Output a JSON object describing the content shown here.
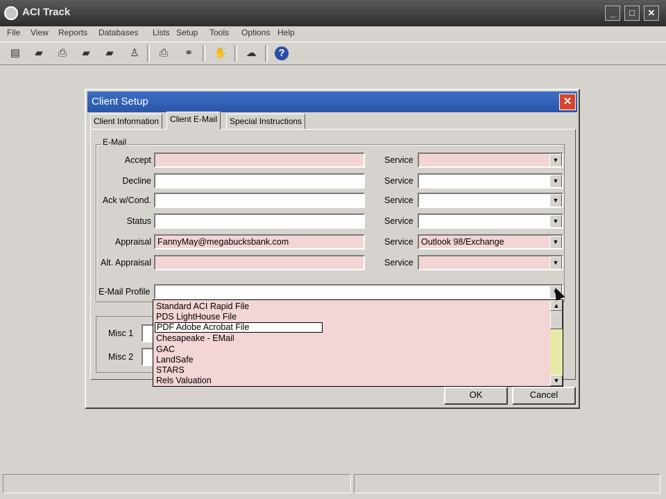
{
  "app": {
    "title": "ACI Track",
    "window_buttons": {
      "minimize": "_",
      "maximize": "□",
      "close": "✕"
    }
  },
  "menu": [
    "File",
    "View",
    "Reports",
    "Databases",
    "Lists",
    "Setup",
    "Tools",
    "Options",
    "Help"
  ],
  "toolbar": {
    "buttons": [
      {
        "icon": "new-document-icon",
        "glyph": "▤"
      },
      {
        "icon": "open-folder-icon",
        "glyph": "▰"
      },
      {
        "icon": "print-icon",
        "glyph": "⎙"
      },
      {
        "icon": "folder-icon",
        "glyph": "▰"
      },
      {
        "icon": "open-file-icon",
        "glyph": "▰"
      },
      {
        "icon": "person-icon",
        "glyph": "♙"
      },
      {
        "icon": "printer-icon",
        "glyph": "⎙"
      },
      {
        "icon": "binoculars-icon",
        "glyph": "⚭"
      },
      {
        "icon": "hand-icon",
        "glyph": "✋"
      },
      {
        "icon": "chat-icon",
        "glyph": "☁"
      },
      {
        "icon": "help-icon",
        "glyph": "?"
      }
    ]
  },
  "dialog": {
    "title": "Client Setup",
    "tabs": [
      "Client Information",
      "Client E-Mail",
      "Special Instructions"
    ],
    "active_tab": "Client E-Mail",
    "email_group_label": "E-Mail",
    "rows": [
      {
        "label": "Accept",
        "value": "",
        "service_label": "Service",
        "service": ""
      },
      {
        "label": "Decline",
        "value": "",
        "service_label": "Service",
        "service": ""
      },
      {
        "label": "Ack w/Cond.",
        "value": "",
        "service_label": "Service",
        "service": ""
      },
      {
        "label": "Status",
        "value": "",
        "service_label": "Service",
        "service": ""
      },
      {
        "label": "Appraisal",
        "value": "FannyMay@megabucksbank.com",
        "service_label": "Service",
        "service": "Outlook 98/Exchange"
      },
      {
        "label": "Alt. Appraisal",
        "value": "",
        "service_label": "Service",
        "service": ""
      }
    ],
    "profile_label": "E-Mail Profile",
    "profile_value": "",
    "misc": [
      {
        "label": "Misc 1"
      },
      {
        "label": "Misc 2"
      }
    ],
    "ok_label": "OK",
    "cancel_label": "Cancel"
  },
  "dropdown": {
    "items": [
      "Standard ACI Rapid File",
      "PDS LightHouse File",
      "PDF Adobe Acrobat File",
      "Chesapeake - EMail",
      "GAC",
      "LandSafe",
      "STARS",
      "Rels Valuation"
    ],
    "selected_index": 2
  },
  "colors": {
    "required_field": "#f3d5d5",
    "dialog_title_bar": "#2b55a8",
    "app_title_bar": "#2c2c2c",
    "face": "#d6d3ce"
  }
}
